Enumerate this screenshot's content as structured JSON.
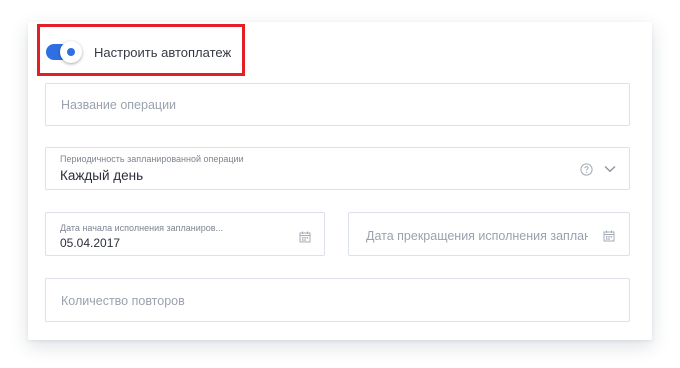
{
  "autopay": {
    "label": "Настроить автоплатеж",
    "enabled": true
  },
  "operation_name": {
    "placeholder": "Название операции"
  },
  "periodicity": {
    "label": "Периодичность запланированной операции",
    "value": "Каждый день",
    "help_icon": "question-circle-icon",
    "dropdown_icon": "chevron-down-icon"
  },
  "start_date": {
    "label": "Дата начала исполнения запланиров...",
    "value": "05.04.2017",
    "icon": "calendar-icon"
  },
  "end_date": {
    "placeholder": "Дата прекращения исполнения заплан...",
    "icon": "calendar-icon"
  },
  "repeat_count": {
    "placeholder": "Количество повторов"
  },
  "colors": {
    "accent": "#2f6fe3",
    "highlight_frame": "#e41e26",
    "border": "#dde2ea"
  }
}
